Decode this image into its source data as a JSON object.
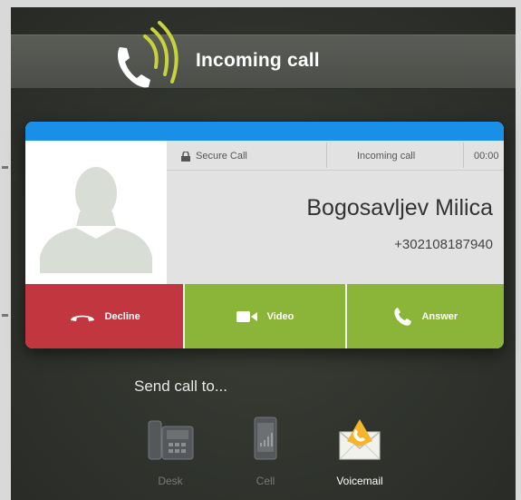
{
  "header": {
    "title": "Incoming call",
    "icon": "phone-ringing-icon"
  },
  "call": {
    "secure_label": "Secure Call",
    "status": "Incoming call",
    "timer": "00:00",
    "caller_name": "Bogosavljev Milica",
    "caller_number": "+302108187940"
  },
  "actions": {
    "decline": "Decline",
    "video": "Video",
    "answer": "Answer"
  },
  "send_to": {
    "label": "Send call to...",
    "options": [
      {
        "label": "Desk",
        "icon": "desk-phone-icon"
      },
      {
        "label": "Cell",
        "icon": "cell-phone-icon"
      },
      {
        "label": "Voicemail",
        "icon": "voicemail-icon"
      }
    ]
  },
  "colors": {
    "accent_blue": "#1a8fe8",
    "decline_red": "#c1363f",
    "accept_green": "#8bb538",
    "ring_yellow": "#c8d23a"
  }
}
